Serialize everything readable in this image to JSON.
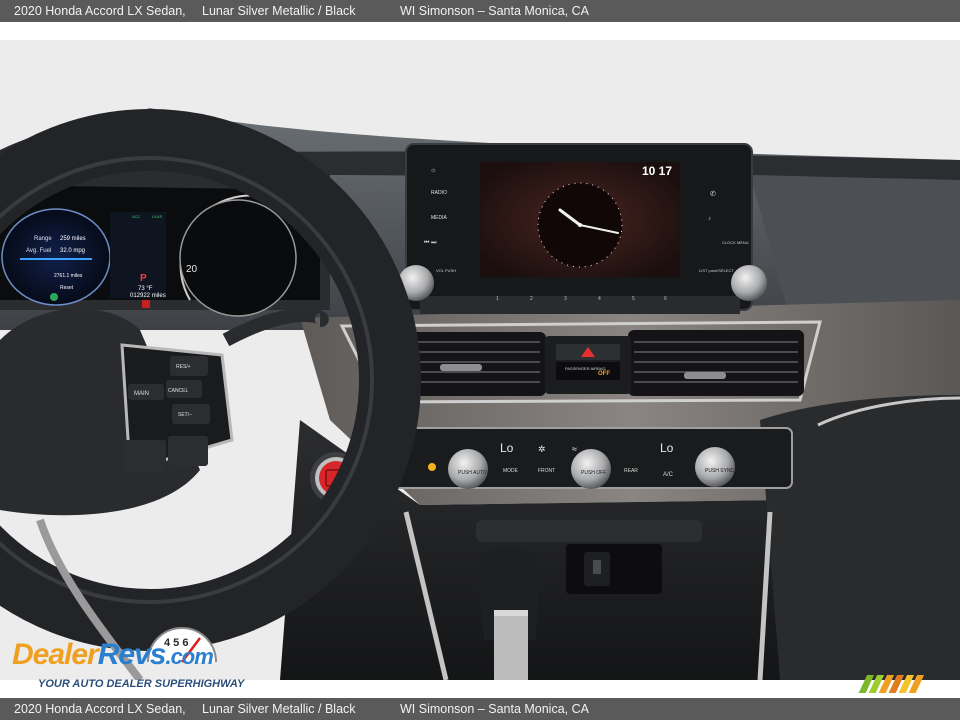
{
  "header": {
    "vehicle": "2020 Honda Accord LX Sedan,",
    "color": "Lunar Silver Metallic / Black",
    "dealer": "WI Simonson – Santa Monica, CA"
  },
  "footer": {
    "vehicle": "2020 Honda Accord LX Sedan,",
    "color": "Lunar Silver Metallic / Black",
    "dealer": "WI Simonson – Santa Monica, CA"
  },
  "cluster": {
    "range_label": "Range",
    "range_value": "259 miles",
    "fuel_label": "Avg. Fuel",
    "fuel_value": "32.0 mpg",
    "trip_value": "2761.1 miles",
    "reset_label": "Reset",
    "gear": "P",
    "temp": "73 °F",
    "odometer": "012922 miles",
    "speed_tick": "20",
    "acc_label": "ACC",
    "lkas_label": "LKAS"
  },
  "infotainment": {
    "time": "10 17",
    "left_buttons": [
      "RADIO",
      "MEDIA"
    ],
    "vol_label": "VOL PUSH",
    "right_buttons": [
      "CLOCK MENU"
    ],
    "list_label": "LIST push/SELECT",
    "presets": [
      "1",
      "2",
      "3",
      "4",
      "5",
      "6"
    ]
  },
  "center_stack": {
    "passenger_airbag": "PASSENGER AIRBAG",
    "airbag_state": "OFF",
    "left_temp": "Lo",
    "right_temp": "Lo",
    "push_auto": "PUSH AUTO",
    "mode": "MODE",
    "front": "FRONT",
    "push_off": "PUSH OFF",
    "rear": "REAR",
    "ac": "A/C",
    "push_sync": "PUSH SYNC"
  },
  "steering": {
    "res": "RES/+",
    "main": "MAIN",
    "cancel": "CANCEL",
    "set": "SET/–"
  },
  "watermark": {
    "brand_a": "Dealer",
    "brand_b": "Revs",
    "brand_c": ".com",
    "tagline": "YOUR AUTO DEALER SUPERHIGHWAY",
    "gauge_digits": "4 5 6"
  },
  "colors": {
    "bar": "#5a5a5a",
    "brand_orange": "#f0a020",
    "brand_blue": "#2a7fcf",
    "start_button_red": "#d8252a"
  }
}
